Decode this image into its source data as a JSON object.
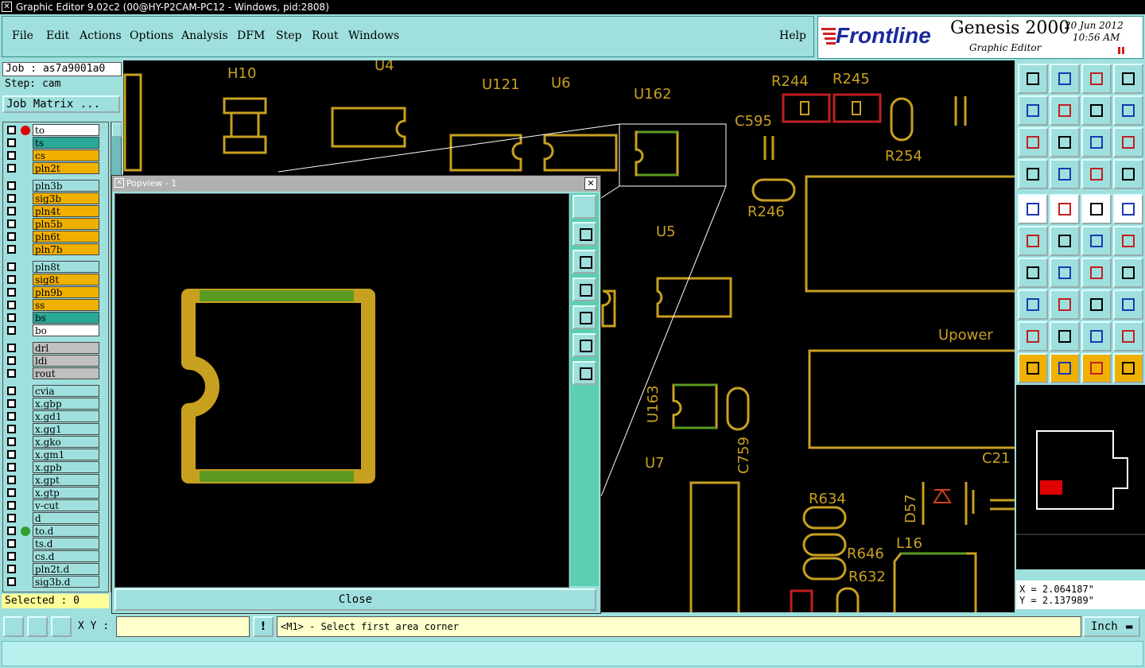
{
  "window": {
    "title": "Graphic Editor 9.02c2 (00@HY-P2CAM-PC12 - Windows, pid:2808)"
  },
  "menu": {
    "items": [
      "File",
      "Edit",
      "Actions",
      "Options",
      "Analysis",
      "DFM",
      "Step",
      "Rout",
      "Windows"
    ],
    "help": "Help"
  },
  "branding": {
    "logo": "Frontline",
    "product": "Genesis 2000",
    "subtitle": "Graphic Editor",
    "date": "20 Jun 2012",
    "time": "10:56 AM"
  },
  "job": {
    "job_label": "Job : as7a9001a0",
    "step_label": "Step: cam",
    "matrix_button": "Job Matrix ..."
  },
  "layers": [
    {
      "name": "to",
      "color": "#ffffff",
      "dot": "#e00000"
    },
    {
      "name": "ts",
      "color": "#2aa898"
    },
    {
      "name": "cs",
      "color": "#f0b000"
    },
    {
      "name": "pln2t",
      "color": "#f0b000"
    },
    {
      "name": "pln3b",
      "color": "#9fe0de"
    },
    {
      "name": "sig3b",
      "color": "#f0b000"
    },
    {
      "name": "pln4t",
      "color": "#f0b000"
    },
    {
      "name": "pln5b",
      "color": "#f0b000"
    },
    {
      "name": "pln6t",
      "color": "#f0b000"
    },
    {
      "name": "pln7b",
      "color": "#f0b000"
    },
    {
      "name": "pln8t",
      "color": "#9fe0de"
    },
    {
      "name": "sig8t",
      "color": "#f0b000"
    },
    {
      "name": "pln9b",
      "color": "#f0b000"
    },
    {
      "name": "ss",
      "color": "#f0b000"
    },
    {
      "name": "bs",
      "color": "#2aa898"
    },
    {
      "name": "bo",
      "color": "#ffffff"
    },
    {
      "name": "drl",
      "color": "#c0c0c0"
    },
    {
      "name": "ldi",
      "color": "#c0c0c0"
    },
    {
      "name": "rout",
      "color": "#c0c0c0"
    },
    {
      "name": "cvia",
      "color": "#9fe0de"
    },
    {
      "name": "x.gbp",
      "color": "#9fe0de"
    },
    {
      "name": "x.gd1",
      "color": "#9fe0de"
    },
    {
      "name": "x.gg1",
      "color": "#9fe0de"
    },
    {
      "name": "x.gko",
      "color": "#9fe0de"
    },
    {
      "name": "x.gm1",
      "color": "#9fe0de"
    },
    {
      "name": "x.gpb",
      "color": "#9fe0de"
    },
    {
      "name": "x.gpt",
      "color": "#9fe0de"
    },
    {
      "name": "x.gtp",
      "color": "#9fe0de"
    },
    {
      "name": "v-cut",
      "color": "#9fe0de"
    },
    {
      "name": "d",
      "color": "#9fe0de"
    },
    {
      "name": "to.d",
      "color": "#9fe0de",
      "dot": "#30a030"
    },
    {
      "name": "ts.d",
      "color": "#9fe0de"
    },
    {
      "name": "cs.d",
      "color": "#9fe0de"
    },
    {
      "name": "pln2t.d",
      "color": "#9fe0de"
    },
    {
      "name": "sig3b.d",
      "color": "#9fe0de"
    }
  ],
  "selected": "Selected : 0",
  "popview": {
    "title": "Popview - 1",
    "close_label": "Close"
  },
  "pcb_labels": [
    "H10",
    "U4",
    "U121",
    "U6",
    "U162",
    "R244",
    "R245",
    "C595",
    "R254",
    "R246",
    "U5",
    "Upower",
    "U163",
    "C759",
    "U7",
    "R634",
    "R646",
    "R632",
    "L16",
    "D57",
    "C21"
  ],
  "coordinates": {
    "x": "X = 2.064187\"",
    "y": "Y = 2.137989\""
  },
  "bottom": {
    "xy_label": "X Y :",
    "xy_value": "",
    "prompt": "<M1> - Select first area corner",
    "unit": "Inch"
  },
  "colors": {
    "copper": "#c8a020",
    "mask": "#5a9a20",
    "panel": "#9fe0de",
    "canvas": "#000000"
  }
}
